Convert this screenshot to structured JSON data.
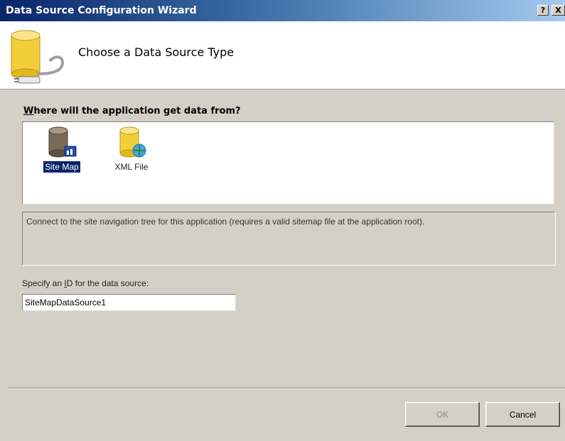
{
  "window": {
    "title": "Data Source Configuration Wizard",
    "help_glyph": "?",
    "close_glyph": "X"
  },
  "header": {
    "title": "Choose a Data Source Type",
    "icon": "database-plug-icon"
  },
  "source_list": {
    "prompt_mnemonic": "W",
    "prompt_rest": "here will the application get data from?",
    "items": [
      {
        "label": "Site Map",
        "icon": "sitemap-database-icon",
        "selected": true
      },
      {
        "label": "XML File",
        "icon": "xml-database-icon",
        "selected": false
      }
    ]
  },
  "description": "Connect to the site navigation tree for this application (requires a valid sitemap file at the application root).",
  "id_field": {
    "label_before": "Specify an ",
    "label_mnemonic": "I",
    "label_after": "D for the data source:",
    "value": "SiteMapDataSource1"
  },
  "buttons": {
    "ok_label": "OK",
    "cancel_label": "Cancel"
  },
  "colors": {
    "titlebar_start": "#0a246a",
    "titlebar_end": "#a6caf0",
    "dialog_bg": "#d4d0c8",
    "selection": "#0a246a"
  }
}
